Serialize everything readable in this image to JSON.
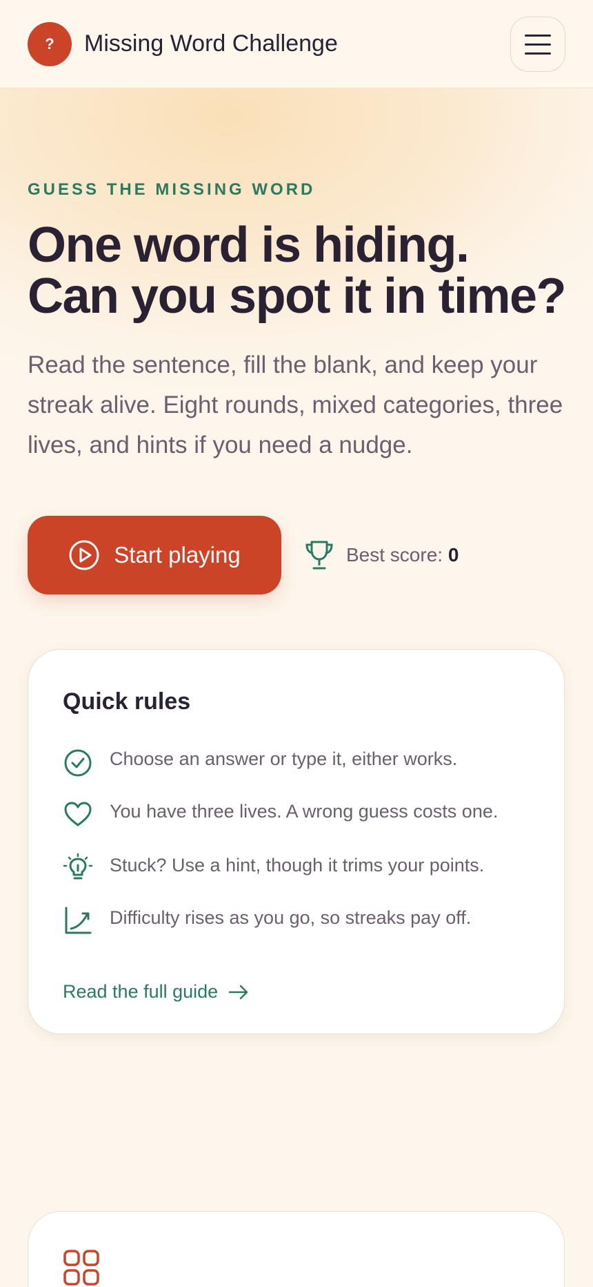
{
  "header": {
    "logo_glyph": "?",
    "title": "Missing Word Challenge",
    "menu_icon": "hamburger-menu-icon"
  },
  "hero": {
    "eyebrow": "GUESS THE MISSING WORD",
    "headline_line1": "One word is hiding.",
    "headline_line2": "Can you spot it in time?",
    "lead": "Read the sentence, fill the blank, and keep your streak alive. Eight rounds, mixed categories, three lives, and hints if you need a nudge.",
    "start_label": "Start playing",
    "best_score_label": "Best score:",
    "best_score_value": "0"
  },
  "rules": {
    "title": "Quick rules",
    "items": [
      {
        "icon": "check-circle-icon",
        "text": "Choose an answer or type it, either works."
      },
      {
        "icon": "heart-icon",
        "text": "You have three lives. A wrong guess costs one."
      },
      {
        "icon": "lightbulb-icon",
        "text": "Stuck? Use a hint, though it trims your points."
      },
      {
        "icon": "trend-up-icon",
        "text": "Difficulty rises as you go, so streaks pay off."
      }
    ],
    "guide_link": "Read the full guide"
  },
  "categories_card": {
    "icon": "grid-icon"
  },
  "colors": {
    "accent": "#cc4428",
    "green": "#2a7a5f",
    "ink": "#2a2233",
    "muted": "#6b5f6e",
    "background": "#fdf6ec"
  }
}
